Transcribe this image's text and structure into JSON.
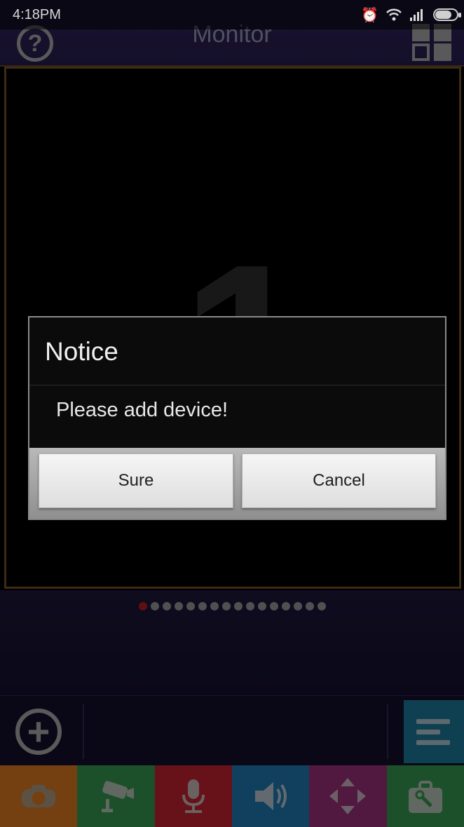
{
  "status_bar": {
    "time": "4:18PM",
    "battery_level": 0.75
  },
  "header": {
    "title": "Monitor",
    "help_icon": "question-circle-icon",
    "layout_icon": "grid-layout-icon"
  },
  "video": {
    "channel_number": "1"
  },
  "pager": {
    "page_count": 16,
    "active_index": 0,
    "active_color": "#a11c1c",
    "inactive_color": "#8a8a8a"
  },
  "toolbar": {
    "add_icon": "plus-circle-icon",
    "menu_icon": "list-menu-icon",
    "menu_color": "#1a6f8e"
  },
  "bottom_tabs": [
    {
      "icon": "camera-rotate-icon",
      "color": "#c86e1e"
    },
    {
      "icon": "cctv-camera-icon",
      "color": "#2f8a4a"
    },
    {
      "icon": "microphone-icon",
      "color": "#b11f2a"
    },
    {
      "icon": "speaker-icon",
      "color": "#1d6fa3"
    },
    {
      "icon": "ptz-arrows-icon",
      "color": "#8c2c6e"
    },
    {
      "icon": "toolbox-icon",
      "color": "#2f8a4a"
    }
  ],
  "dialog": {
    "title": "Notice",
    "message": "Please add device!",
    "sure_label": "Sure",
    "cancel_label": "Cancel"
  }
}
